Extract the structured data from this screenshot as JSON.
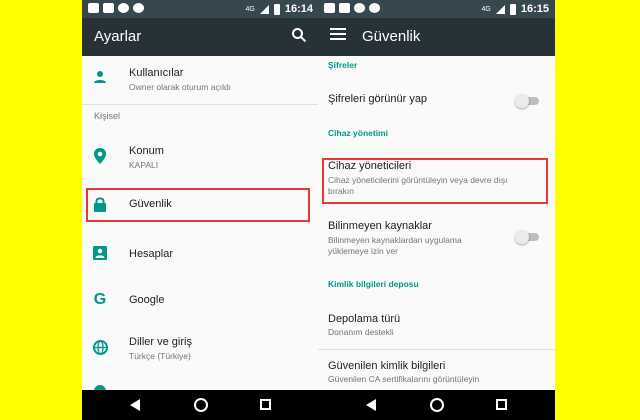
{
  "left_screen": {
    "status": {
      "net_label": "4G",
      "time": "16:14"
    },
    "title": "Ayarlar",
    "icons": {
      "search": "search-icon"
    },
    "items": [
      {
        "title": "Kullanıcılar",
        "subtitle": "Owner olarak oturum açıldı",
        "icon": "person-icon"
      },
      {
        "title": "Konum",
        "subtitle": "KAPALI",
        "icon": "location-icon"
      },
      {
        "title": "Güvenlik",
        "icon": "lock-icon"
      },
      {
        "title": "Hesaplar",
        "icon": "account-box-icon"
      },
      {
        "title": "Google",
        "icon": "google-icon"
      },
      {
        "title": "Diller ve giriş",
        "subtitle": "Türkçe (Türkiye)",
        "icon": "globe-icon"
      }
    ],
    "section_personal": "Kişisel"
  },
  "right_screen": {
    "status": {
      "net_label": "4G",
      "time": "16:15"
    },
    "title": "Güvenlik",
    "icons": {
      "menu": "menu-icon"
    },
    "section_passwords": "Şifreler",
    "show_passwords": "Şifreleri görünür yap",
    "section_device_admin": "Cihaz yönetimi",
    "device_admins": {
      "title": "Cihaz yöneticileri",
      "subtitle": "Cihaz yöneticilerini görüntüleyin veya devre dışı bırakın"
    },
    "unknown_sources": {
      "title": "Bilinmeyen kaynaklar",
      "subtitle": "Bilinmeyen kaynaklardan uygulama yüklemeye izin ver"
    },
    "section_credentials": "Kimlik bilgileri deposu",
    "storage_type": {
      "title": "Depolama türü",
      "subtitle": "Donanım destekli"
    },
    "trusted_credentials": {
      "title": "Güvenilen kimlik bilgileri",
      "subtitle": "Güvenilen CA sertifikalarını görüntüleyin"
    }
  },
  "colors": {
    "background": "#ffff00",
    "appbar": "#263238",
    "statusbar": "#37474f",
    "accent": "#009688",
    "highlight": "#e53935"
  }
}
